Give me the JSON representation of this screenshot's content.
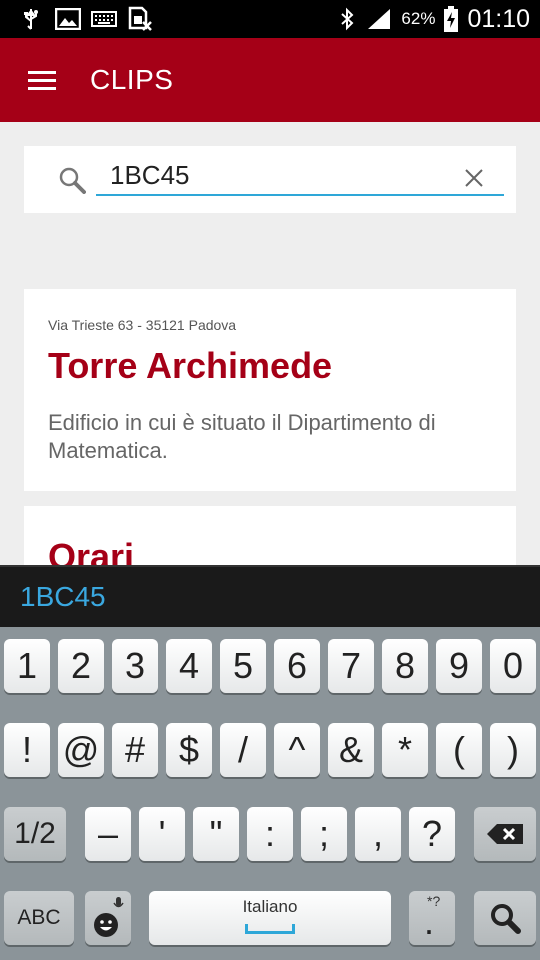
{
  "status_bar": {
    "battery_percent": "62%",
    "time": "01:10",
    "icons": [
      "usb-icon",
      "image-icon",
      "keyboard-icon",
      "sim-error-icon",
      "bluetooth-icon",
      "signal-icon",
      "battery-charging-icon"
    ]
  },
  "app_bar": {
    "title": "CLIPS",
    "menu_icon": "hamburger-menu-icon",
    "color": "#a50017"
  },
  "search": {
    "value": "1BC45",
    "icon": "search-icon",
    "clear_icon": "close-icon",
    "underline_color": "#2ea7d8"
  },
  "cards": [
    {
      "address": "Via Trieste 63 - 35121 Padova",
      "title": "Torre Archimede",
      "description": "Edificio in cui è situato il Dipartimento di Matematica."
    },
    {
      "title": "Orari"
    }
  ],
  "keyboard": {
    "suggestion": "1BC45",
    "row1": [
      "1",
      "2",
      "3",
      "4",
      "5",
      "6",
      "7",
      "8",
      "9",
      "0"
    ],
    "row2": [
      "!",
      "@",
      "#",
      "$",
      "/",
      "^",
      "&",
      "*",
      "(",
      ")"
    ],
    "row3": [
      "1/2",
      "–",
      "'",
      "\"",
      ":",
      ";",
      ",",
      "?"
    ],
    "row3_backspace_icon": "backspace-icon",
    "row4": {
      "abc": "ABC",
      "emoji_icon": "emoji-mic-icon",
      "space": "Italiano",
      "period": ".",
      "period_hint": "*?",
      "search_icon": "search-icon"
    }
  }
}
